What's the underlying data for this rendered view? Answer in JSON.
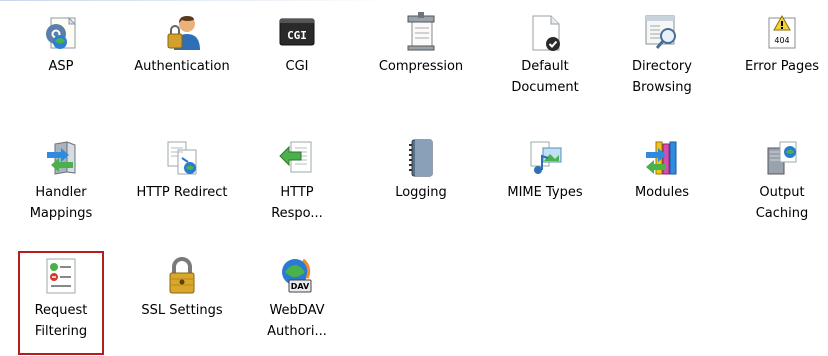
{
  "features": [
    {
      "label": "ASP",
      "icon": "asp-icon"
    },
    {
      "label": "Authentication",
      "icon": "authentication-icon"
    },
    {
      "label": "CGI",
      "icon": "cgi-icon",
      "icon_text": "CGI"
    },
    {
      "label": "Compression",
      "icon": "compression-icon"
    },
    {
      "label": "Default\nDocument",
      "icon": "default-document-icon"
    },
    {
      "label": "Directory\nBrowsing",
      "icon": "directory-browsing-icon"
    },
    {
      "label": "Error Pages",
      "icon": "error-pages-icon",
      "icon_text": "404"
    },
    {
      "label": "Handler\nMappings",
      "icon": "handler-mappings-icon"
    },
    {
      "label": "HTTP Redirect",
      "icon": "http-redirect-icon"
    },
    {
      "label": "HTTP\nRespo...",
      "icon": "http-response-headers-icon"
    },
    {
      "label": "Logging",
      "icon": "logging-icon"
    },
    {
      "label": "MIME Types",
      "icon": "mime-types-icon"
    },
    {
      "label": "Modules",
      "icon": "modules-icon"
    },
    {
      "label": "Output\nCaching",
      "icon": "output-caching-icon"
    },
    {
      "label": "Request\nFiltering",
      "icon": "request-filtering-icon",
      "selected": true
    },
    {
      "label": "SSL Settings",
      "icon": "ssl-settings-icon"
    },
    {
      "label": "WebDAV\nAuthori...",
      "icon": "webdav-authoring-icon",
      "icon_text": "DAV"
    }
  ],
  "colors": {
    "selection_border": "#b41e1e"
  }
}
